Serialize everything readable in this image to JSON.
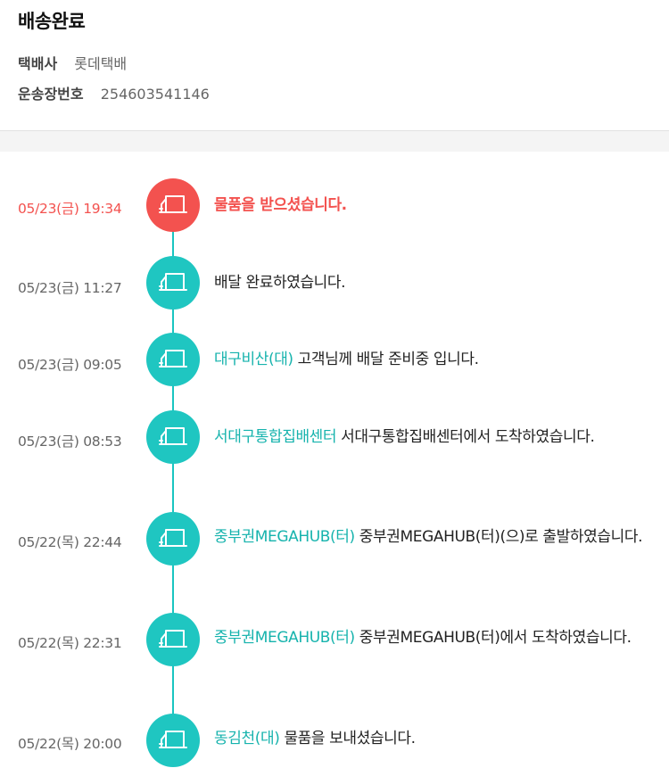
{
  "header": {
    "title": "배송완료",
    "courier_label": "택배사",
    "courier_value": "롯데택배",
    "tracking_label": "운송장번호",
    "tracking_value": "254603541146"
  },
  "colors": {
    "accent_teal": "#1fc6c1",
    "location_text": "#16b3ad",
    "latest_red": "#f3524f"
  },
  "icon": "delivery-truck-icon",
  "events": [
    {
      "time": "05/23(금) 19:34",
      "location": "",
      "message": "물품을 받으셨습니다."
    },
    {
      "time": "05/23(금) 11:27",
      "location": "",
      "message": "배달 완료하였습니다."
    },
    {
      "time": "05/23(금) 09:05",
      "location": "대구비산(대)",
      "message": " 고객님께 배달 준비중 입니다."
    },
    {
      "time": "05/23(금) 08:53",
      "location": "서대구통합집배센터",
      "message": " 서대구통합집배센터에서 도착하였습니다."
    },
    {
      "time": "05/22(목) 22:44",
      "location": "중부권MEGAHUB(터)",
      "message": " 중부권MEGAHUB(터)(으)로 출발하였습니다."
    },
    {
      "time": "05/22(목) 22:31",
      "location": "중부권MEGAHUB(터)",
      "message": " 중부권MEGAHUB(터)에서 도착하였습니다."
    },
    {
      "time": "05/22(목) 20:00",
      "location": "동김천(대)",
      "message": " 물품을 보내셨습니다."
    }
  ]
}
